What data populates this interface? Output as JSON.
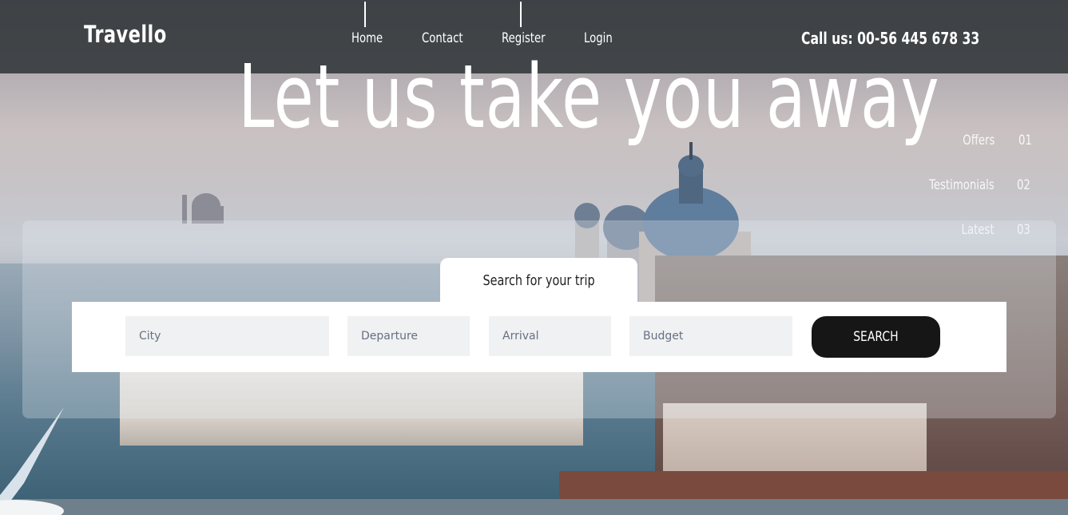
{
  "brand": {
    "name": "Travello"
  },
  "nav": {
    "items": [
      "Home",
      "Contact",
      "Register",
      "Login"
    ]
  },
  "contact": {
    "call": "Call us: 00-56 445 678 33"
  },
  "hero": {
    "title": "Let us take you away"
  },
  "side_nav": {
    "items": [
      {
        "label": "Offers",
        "num": "01"
      },
      {
        "label": "Testimonials",
        "num": "02"
      },
      {
        "label": "Latest",
        "num": "03"
      }
    ]
  },
  "search": {
    "tab_label": "Search for your trip",
    "city_placeholder": "City",
    "departure_placeholder": "Departure",
    "arrival_placeholder": "Arrival",
    "budget_placeholder": "Budget",
    "button_label": "SEARCH"
  },
  "colors": {
    "header_bg": "#373c3f",
    "search_button": "#161616",
    "field_bg": "#eff1f3"
  }
}
